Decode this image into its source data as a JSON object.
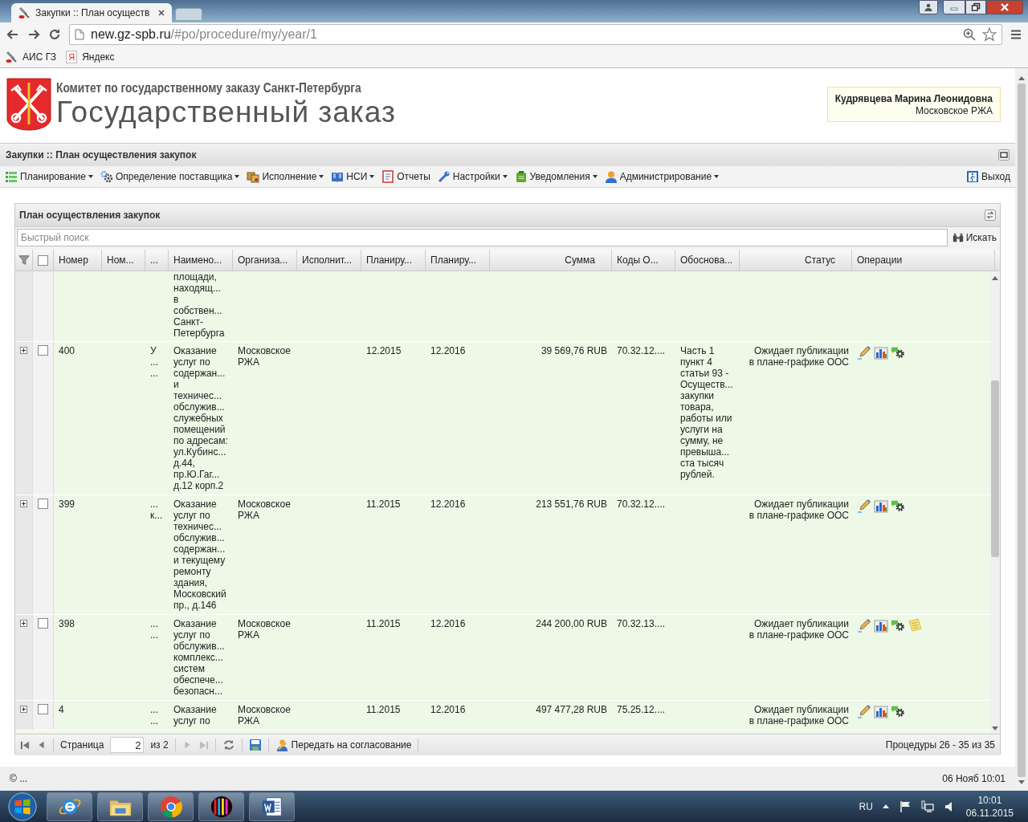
{
  "browser": {
    "tab_title": "Закупки :: План осуществ",
    "url_host": "new.gz-spb.ru",
    "url_path": "/#po/procedure/my/year/1",
    "bookmarks": [
      {
        "kind": "tool",
        "label": "АИС ГЗ"
      },
      {
        "kind": "yandex",
        "badge": "Я",
        "label": "Яндекс"
      }
    ]
  },
  "header": {
    "committee": "Комитет по государственному заказу Санкт-Петербурга",
    "title": "Государственный заказ",
    "user_name": "Кудрявцева Марина Леонидовна",
    "user_org": "Московское РЖА"
  },
  "breadcrumb": "Закупки :: План осуществления закупок",
  "menu": [
    {
      "kind": "planning",
      "label": "Планирование",
      "dropdown": true
    },
    {
      "kind": "supplier",
      "label": "Определение поставщика",
      "dropdown": true
    },
    {
      "kind": "execution",
      "label": "Исполнение",
      "dropdown": true
    },
    {
      "kind": "reference",
      "label": "НСИ",
      "dropdown": true
    },
    {
      "kind": "reports",
      "label": "Отчеты",
      "dropdown": false
    },
    {
      "kind": "settings",
      "label": "Настройки",
      "dropdown": true
    },
    {
      "kind": "notifications",
      "label": "Уведомления",
      "dropdown": true
    },
    {
      "kind": "admin",
      "label": "Администрирование",
      "dropdown": true
    }
  ],
  "logout": "Выход",
  "panel": {
    "title": "План осуществления закупок",
    "search": {
      "placeholder": "Быстрый поиск",
      "button": "Искать"
    }
  },
  "table": {
    "header_checked": false,
    "columns": [
      "Номер",
      "Ном...",
      "...",
      "Наимено...",
      "Организа...",
      "Исполнит...",
      "Планиру...",
      "Планиру...",
      "Сумма",
      "Коды О...",
      "Обоснова...",
      "Статус",
      "Операции"
    ],
    "rows": [
      {
        "cells": [
          null,
          null,
          null,
          "площади,\nнаходящ...\nв\nсобствен...\nСанкт-\nПетербурга",
          null,
          null,
          null,
          null,
          null,
          null,
          null,
          null
        ]
      },
      {
        "expanded": false,
        "checked": false,
        "cells": [
          "400",
          null,
          "У\n...\n...",
          "Оказание\nуслуг по\nсодержан...\nи\nтехничес...\nобслужив...\nслужебных\nпомещений\nпо адресам:\nул.Кубинс...\nд.44,\nпр.Ю.Гаг...\nд.12 корп.2",
          "Московское\nРЖА",
          null,
          "12.2015",
          "12.2016",
          "39 569,76 RUB",
          "70.32.12....",
          "Часть 1\nпункт 4\nстатьи 93 -\nОсуществ...\nзакупки\nтовара,\nработы или\nуслуги на\nсумму, не\nпревыша...\nста тысяч\nрублей.",
          "Ожидает публикации\nв плане-графике ООС"
        ],
        "actions": [
          {
            "kind": "edit"
          },
          {
            "kind": "chart"
          },
          {
            "kind": "gear"
          }
        ]
      },
      {
        "expanded": false,
        "checked": false,
        "cells": [
          "399",
          null,
          "...\nк...",
          "Оказание\nуслуг по\nтехничес...\nобслужив...\nсодержан...\nи текущему\nремонту\nздания,\nМосковский\nпр., д.146",
          "Московское\nРЖА",
          null,
          "11.2015",
          "12.2016",
          "213 551,76 RUB",
          "70.32.12....",
          null,
          "Ожидает публикации\nв плане-графике ООС"
        ],
        "actions": [
          {
            "kind": "edit"
          },
          {
            "kind": "chart"
          },
          {
            "kind": "gear"
          }
        ]
      },
      {
        "expanded": false,
        "checked": false,
        "cells": [
          "398",
          null,
          "...\n...",
          "Оказание\nуслуг по\nобслужив...\nкомплекс...\nсистем\nобеспече...\nбезопасн...",
          "Московское\nРЖА",
          null,
          "11.2015",
          "12.2016",
          "244 200,00 RUB",
          "70.32.13....",
          null,
          "Ожидает публикации\nв плане-графике ООС"
        ],
        "actions": [
          {
            "kind": "edit"
          },
          {
            "kind": "chart"
          },
          {
            "kind": "gear"
          },
          {
            "kind": "note"
          }
        ]
      },
      {
        "expanded": false,
        "checked": false,
        "cells": [
          "4",
          null,
          "...\n...",
          "Оказание\nуслуг по",
          "Московское\nРЖА",
          null,
          "11.2015",
          "12.2016",
          "497 477,28 RUB",
          "75.25.12....",
          null,
          "Ожидает публикации\nв плане-графике ООС"
        ],
        "actions": [
          {
            "kind": "edit"
          },
          {
            "kind": "chart"
          },
          {
            "kind": "gear"
          }
        ]
      }
    ]
  },
  "pager": {
    "page_label": "Страница",
    "page": "2",
    "of": "из 2",
    "send": "Передать на согласование",
    "summary": "Процедуры 26 - 35 из 35"
  },
  "footer": {
    "copyright": "© ...",
    "datetime": "06 Нояб 10:01"
  },
  "taskbar": {
    "apps": [
      {
        "kind": "ie"
      },
      {
        "kind": "explorer"
      },
      {
        "kind": "chrome"
      },
      {
        "kind": "lines"
      },
      {
        "kind": "word"
      }
    ],
    "lang": "RU",
    "time": "10:01",
    "date": "06.11.2015"
  }
}
